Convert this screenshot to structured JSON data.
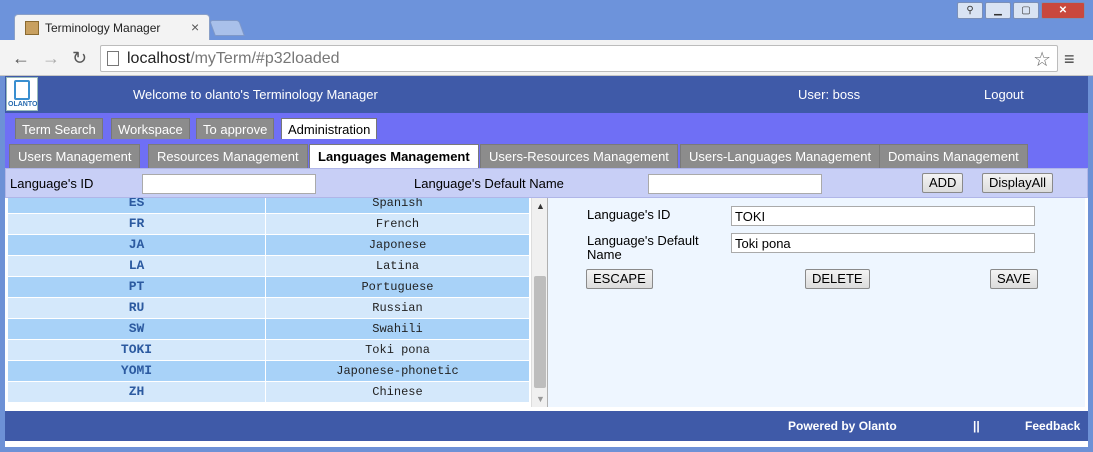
{
  "browser": {
    "tab_title": "Terminology Manager",
    "tab_close": "×",
    "url_host": "localhost",
    "url_path": "/myTerm/#p32loaded",
    "nav_back": "←",
    "nav_forward": "→",
    "nav_reload": "↻",
    "star": "☆",
    "menu": "≡",
    "win_user": "⚲",
    "win_min": "▁",
    "win_max": "▢",
    "win_close": "✕"
  },
  "header": {
    "logo_text": "OLANTO",
    "welcome": "Welcome to olanto's Terminology Manager",
    "user": "User: boss",
    "logout": "Logout"
  },
  "main_tabs": [
    {
      "label": "Term Search"
    },
    {
      "label": "Workspace"
    },
    {
      "label": "To approve"
    },
    {
      "label": "Administration"
    }
  ],
  "sub_tabs": [
    {
      "label": "Users Management"
    },
    {
      "label": "Resources Management"
    },
    {
      "label": "Languages Management"
    },
    {
      "label": "Users-Resources Management"
    },
    {
      "label": "Users-Languages Management"
    },
    {
      "label": "Domains Management"
    }
  ],
  "filter": {
    "id_label": "Language's ID",
    "id_value": "",
    "name_label": "Language's Default Name",
    "name_value": "",
    "add_label": "ADD",
    "display_all_label": "DisplayAll"
  },
  "languages": [
    {
      "id": "ES",
      "name": "Spanish"
    },
    {
      "id": "FR",
      "name": "French"
    },
    {
      "id": "JA",
      "name": "Japonese"
    },
    {
      "id": "LA",
      "name": "Latina"
    },
    {
      "id": "PT",
      "name": "Portuguese"
    },
    {
      "id": "RU",
      "name": "Russian"
    },
    {
      "id": "SW",
      "name": "Swahili"
    },
    {
      "id": "TOKI",
      "name": "Toki pona"
    },
    {
      "id": "YOMI",
      "name": "Japonese-phonetic"
    },
    {
      "id": "ZH",
      "name": "Chinese"
    }
  ],
  "detail": {
    "id_label": "Language's ID",
    "id_value": "TOKI",
    "name_label": "Language's Default Name",
    "name_value": "Toki pona",
    "escape_label": "ESCAPE",
    "delete_label": "DELETE",
    "save_label": "SAVE"
  },
  "footer": {
    "powered": "Powered by Olanto",
    "separator": "||",
    "feedback": "Feedback"
  },
  "colors": {
    "header_bg": "#3f5aa8",
    "tabbar_bg": "#6f6ff5",
    "filter_bg": "#c8cff6",
    "row_even": "#a8d2f8",
    "row_odd": "#d4e8fb",
    "id_text": "#2c5aa0"
  }
}
